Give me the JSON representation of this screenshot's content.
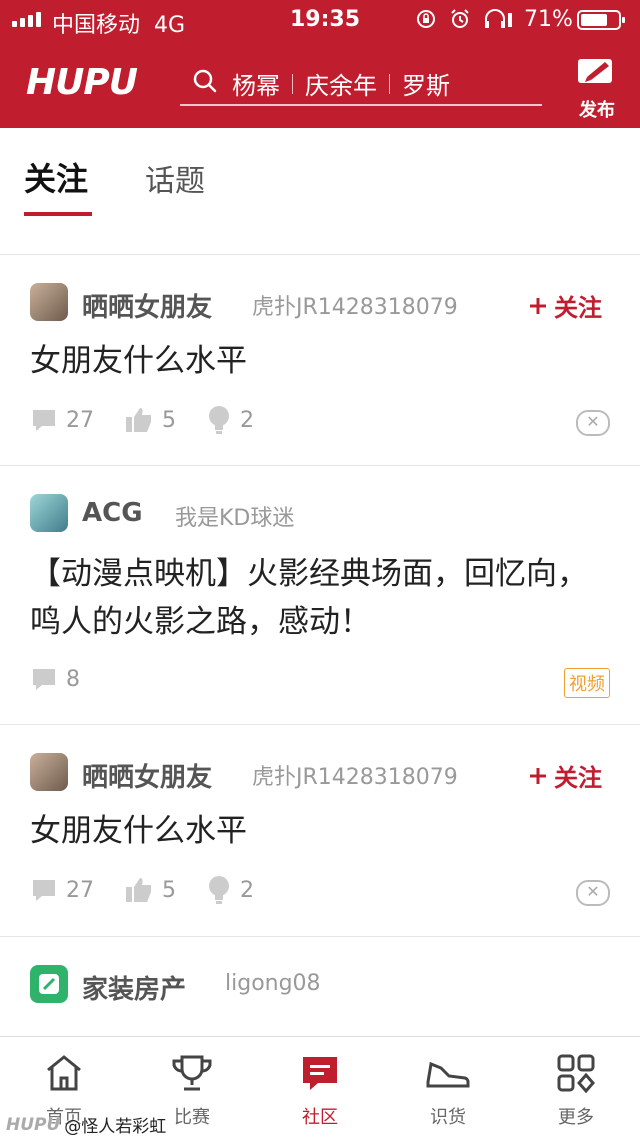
{
  "status_bar": {
    "carrier": "中国移动",
    "network": "4G",
    "time": "19:35",
    "battery_text": "71%",
    "battery_level": 0.71
  },
  "nav": {
    "logo": "HUPU",
    "search_hints": [
      "杨幂",
      "庆余年",
      "罗斯"
    ],
    "publish_label": "发布"
  },
  "tabs": [
    {
      "label": "关注",
      "active": true
    },
    {
      "label": "话题",
      "active": false
    }
  ],
  "posts": [
    {
      "board": "晒晒女朋友",
      "author": "虎扑JR1428318079",
      "follow_label": "关注",
      "title": "女朋友什么水平",
      "comments": "27",
      "likes": "5",
      "lights": "2"
    },
    {
      "board": "ACG",
      "author": "我是KD球迷",
      "title": "【动漫点映机】火影经典场面，回忆向，鸣人的火影之路，感动！",
      "comments": "8",
      "badge": "视频"
    },
    {
      "board": "晒晒女朋友",
      "author": "虎扑JR1428318079",
      "follow_label": "关注",
      "title": "女朋友什么水平",
      "comments": "27",
      "likes": "5",
      "lights": "2"
    },
    {
      "board": "家装房产",
      "author": "ligong08"
    }
  ],
  "bottom_nav": [
    {
      "label": "首页",
      "icon": "home-icon"
    },
    {
      "label": "比赛",
      "icon": "trophy-icon"
    },
    {
      "label": "社区",
      "icon": "community-icon",
      "active": true
    },
    {
      "label": "识货",
      "icon": "sneaker-icon"
    },
    {
      "label": "更多",
      "icon": "grid-icon"
    }
  ],
  "watermark": {
    "logo": "HUPU",
    "text": "@怪人若彩虹"
  },
  "colors": {
    "brand": "#c01e2f",
    "video_badge": "#f0a030"
  }
}
